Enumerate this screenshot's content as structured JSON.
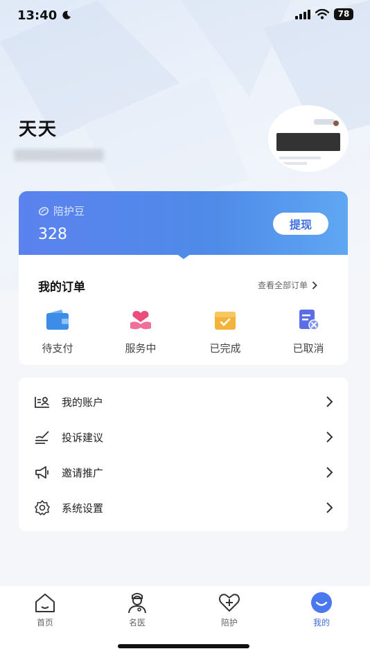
{
  "status": {
    "time": "13:40",
    "battery": "78"
  },
  "profile": {
    "name": "天天"
  },
  "balance": {
    "label": "陪护豆",
    "value": "328",
    "withdraw_label": "提现"
  },
  "orders": {
    "title": "我的订单",
    "view_all": "查看全部订单",
    "items": [
      {
        "label": "待支付",
        "icon": "wallet-icon",
        "color": "#3d8de8"
      },
      {
        "label": "服务中",
        "icon": "hands-heart-icon",
        "color": "#ec4d7c"
      },
      {
        "label": "已完成",
        "icon": "box-check-icon",
        "color": "#f3b33a"
      },
      {
        "label": "已取消",
        "icon": "doc-cancel-icon",
        "color": "#5b6ee8"
      }
    ]
  },
  "menu": {
    "items": [
      {
        "label": "我的账户",
        "icon": "account-icon"
      },
      {
        "label": "投诉建议",
        "icon": "feedback-icon"
      },
      {
        "label": "邀请推广",
        "icon": "megaphone-icon"
      },
      {
        "label": "系统设置",
        "icon": "gear-icon"
      }
    ]
  },
  "tabbar": {
    "items": [
      {
        "label": "首页",
        "icon": "home-icon"
      },
      {
        "label": "名医",
        "icon": "doctor-icon"
      },
      {
        "label": "陪护",
        "icon": "heart-plus-icon"
      },
      {
        "label": "我的",
        "icon": "smile-icon",
        "active": true
      }
    ]
  },
  "colors": {
    "accent": "#3f6fe0",
    "balance_gradient_start": "#5b82ee",
    "balance_gradient_end": "#5fa7f3"
  }
}
